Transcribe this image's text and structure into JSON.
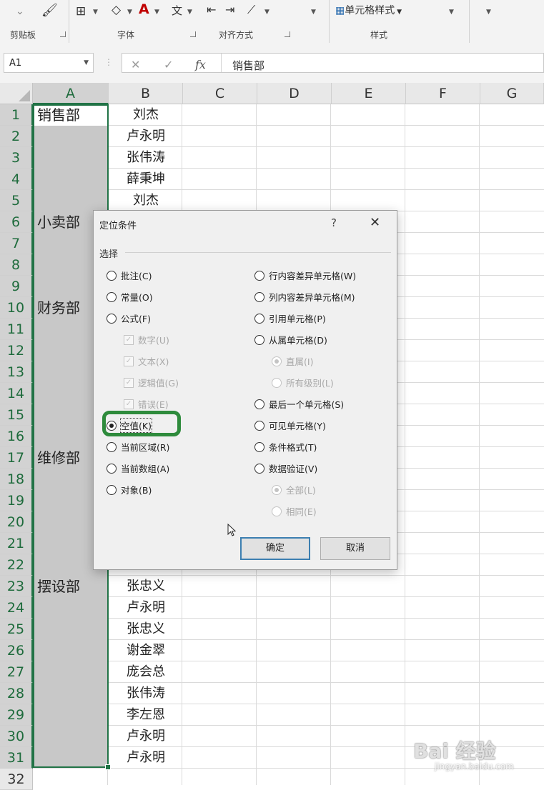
{
  "ribbon": {
    "groups": [
      {
        "label": "剪贴板"
      },
      {
        "label": "字体"
      },
      {
        "label": "对齐方式"
      },
      {
        "label": "样式"
      }
    ],
    "cell_styles_label": "单元格样式"
  },
  "formula_bar": {
    "name_box": "A1",
    "fx_label": "fx",
    "cancel_glyph": "✕",
    "enter_glyph": "✓",
    "content": "销售部"
  },
  "sheet": {
    "columns": [
      "A",
      "B",
      "C",
      "D",
      "E",
      "F",
      "G"
    ],
    "rows": [
      "1",
      "2",
      "3",
      "4",
      "5",
      "6",
      "7",
      "8",
      "9",
      "10",
      "11",
      "12",
      "13",
      "14",
      "15",
      "16",
      "17",
      "18",
      "19",
      "20",
      "21",
      "22",
      "23",
      "24",
      "25",
      "26",
      "27",
      "28",
      "29",
      "30",
      "31",
      "32"
    ],
    "col_a_values": [
      {
        "row": 1,
        "text": "销售部"
      },
      {
        "row": 6,
        "text": "小卖部"
      },
      {
        "row": 10,
        "text": "财务部"
      },
      {
        "row": 17,
        "text": "维修部"
      },
      {
        "row": 23,
        "text": "摆设部"
      }
    ],
    "col_b_values": [
      {
        "row": 1,
        "text": "刘杰"
      },
      {
        "row": 2,
        "text": "卢永明"
      },
      {
        "row": 3,
        "text": "张伟涛"
      },
      {
        "row": 4,
        "text": "薛秉坤"
      },
      {
        "row": 5,
        "text": "刘杰"
      },
      {
        "row": 23,
        "text": "张忠义"
      },
      {
        "row": 24,
        "text": "卢永明"
      },
      {
        "row": 25,
        "text": "张忠义"
      },
      {
        "row": 26,
        "text": "谢金翠"
      },
      {
        "row": 27,
        "text": "庞会总"
      },
      {
        "row": 28,
        "text": "张伟涛"
      },
      {
        "row": 29,
        "text": "李左恩"
      },
      {
        "row": 30,
        "text": "卢永明"
      },
      {
        "row": 31,
        "text": "卢永明"
      }
    ]
  },
  "dialog": {
    "title": "定位条件",
    "help": "?",
    "close": "✕",
    "group_label": "选择",
    "left_options": [
      {
        "key": "comments",
        "label": "批注(C)",
        "type": "radio",
        "checked": false,
        "disabled": false
      },
      {
        "key": "constants",
        "label": "常量(O)",
        "type": "radio",
        "checked": false,
        "disabled": false
      },
      {
        "key": "formulas",
        "label": "公式(F)",
        "type": "radio",
        "checked": false,
        "disabled": false
      },
      {
        "key": "numbers",
        "label": "数字(U)",
        "type": "checkbox",
        "checked": true,
        "disabled": true
      },
      {
        "key": "text",
        "label": "文本(X)",
        "type": "checkbox",
        "checked": true,
        "disabled": true
      },
      {
        "key": "logicals",
        "label": "逻辑值(G)",
        "type": "checkbox",
        "checked": true,
        "disabled": true
      },
      {
        "key": "errors",
        "label": "错误(E)",
        "type": "checkbox",
        "checked": true,
        "disabled": true
      },
      {
        "key": "blanks",
        "label": "空值(K)",
        "type": "radio",
        "checked": true,
        "disabled": false
      },
      {
        "key": "current_region",
        "label": "当前区域(R)",
        "type": "radio",
        "checked": false,
        "disabled": false
      },
      {
        "key": "current_array",
        "label": "当前数组(A)",
        "type": "radio",
        "checked": false,
        "disabled": false
      },
      {
        "key": "objects",
        "label": "对象(B)",
        "type": "radio",
        "checked": false,
        "disabled": false
      }
    ],
    "right_options": [
      {
        "key": "row_differences",
        "label": "行内容差异单元格(W)",
        "type": "radio",
        "checked": false,
        "disabled": false
      },
      {
        "key": "column_differences",
        "label": "列内容差异单元格(M)",
        "type": "radio",
        "checked": false,
        "disabled": false
      },
      {
        "key": "precedents",
        "label": "引用单元格(P)",
        "type": "radio",
        "checked": false,
        "disabled": false
      },
      {
        "key": "dependents",
        "label": "从属单元格(D)",
        "type": "radio",
        "checked": false,
        "disabled": false
      },
      {
        "key": "direct_only",
        "label": "直属(I)",
        "type": "radio",
        "checked": true,
        "disabled": true
      },
      {
        "key": "all_levels",
        "label": "所有级别(L)",
        "type": "radio",
        "checked": false,
        "disabled": true
      },
      {
        "key": "last_cell",
        "label": "最后一个单元格(S)",
        "type": "radio",
        "checked": false,
        "disabled": false
      },
      {
        "key": "visible_cells",
        "label": "可见单元格(Y)",
        "type": "radio",
        "checked": false,
        "disabled": false
      },
      {
        "key": "conditional_formats",
        "label": "条件格式(T)",
        "type": "radio",
        "checked": false,
        "disabled": false
      },
      {
        "key": "data_validation",
        "label": "数据验证(V)",
        "type": "radio",
        "checked": false,
        "disabled": false
      },
      {
        "key": "validation_all",
        "label": "全部(L)",
        "type": "radio",
        "checked": true,
        "disabled": true
      },
      {
        "key": "validation_same",
        "label": "相同(E)",
        "type": "radio",
        "checked": false,
        "disabled": true
      }
    ],
    "ok_label": "确定",
    "cancel_label": "取消"
  },
  "watermark": {
    "text": "Bai 经验",
    "sub": "jingyan.baidu.com"
  },
  "colors": {
    "accent_green": "#217346",
    "highlight_ring": "#2e8b3c",
    "selection_gray": "#c8c8c8"
  }
}
